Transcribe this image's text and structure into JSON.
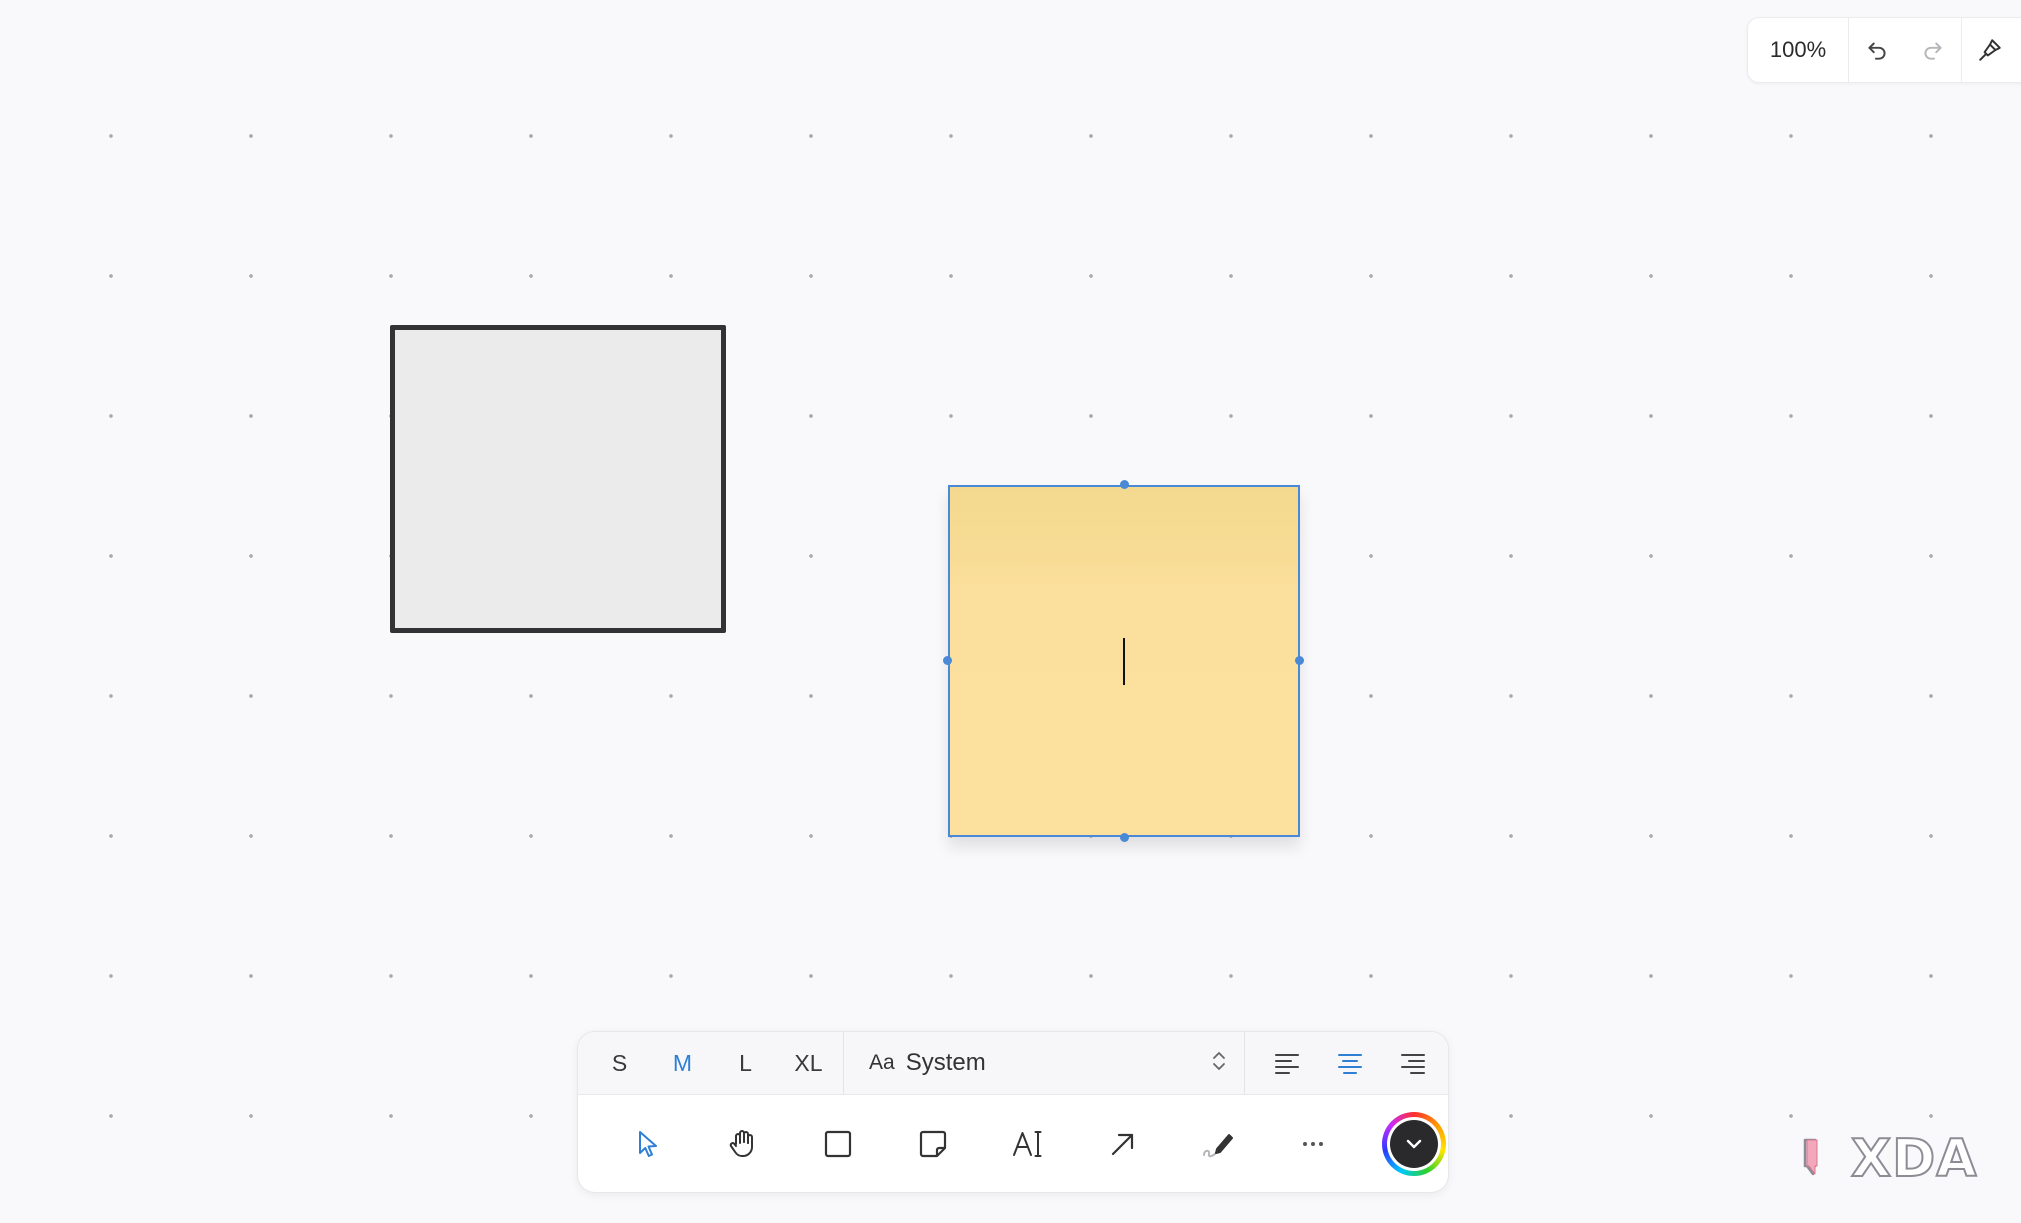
{
  "top_bar": {
    "zoom_level": "100%",
    "undo_icon": "undo-icon",
    "redo_icon": "redo-icon",
    "style_icon": "paint-brush-icon"
  },
  "canvas": {
    "rectangle": {
      "fill": "#ebebeb",
      "stroke": "#333335"
    },
    "sticky_note": {
      "fill": "#fbe09e",
      "selection_color": "#4a89d6",
      "text": ""
    }
  },
  "toolbar": {
    "sizes": [
      "S",
      "M",
      "L",
      "XL"
    ],
    "active_size": "M",
    "font": {
      "prefix": "Aa",
      "name": "System"
    },
    "alignments": [
      "left",
      "center",
      "right"
    ],
    "active_alignment": "center",
    "tools": [
      {
        "name": "select",
        "icon": "cursor-icon",
        "active": true
      },
      {
        "name": "hand",
        "icon": "hand-icon",
        "active": false
      },
      {
        "name": "rectangle",
        "icon": "square-icon",
        "active": false
      },
      {
        "name": "sticky-note",
        "icon": "sticky-note-icon",
        "active": false
      },
      {
        "name": "text",
        "icon": "text-icon",
        "active": false
      },
      {
        "name": "arrow",
        "icon": "arrow-icon",
        "active": false
      },
      {
        "name": "draw",
        "icon": "pen-icon",
        "active": false
      },
      {
        "name": "more",
        "icon": "more-icon",
        "active": false
      }
    ],
    "color": {
      "current": "#2a2a2c",
      "icon": "chevron-down-icon"
    },
    "accent": "#2f7fd4"
  },
  "watermark": {
    "text": "XDA"
  }
}
